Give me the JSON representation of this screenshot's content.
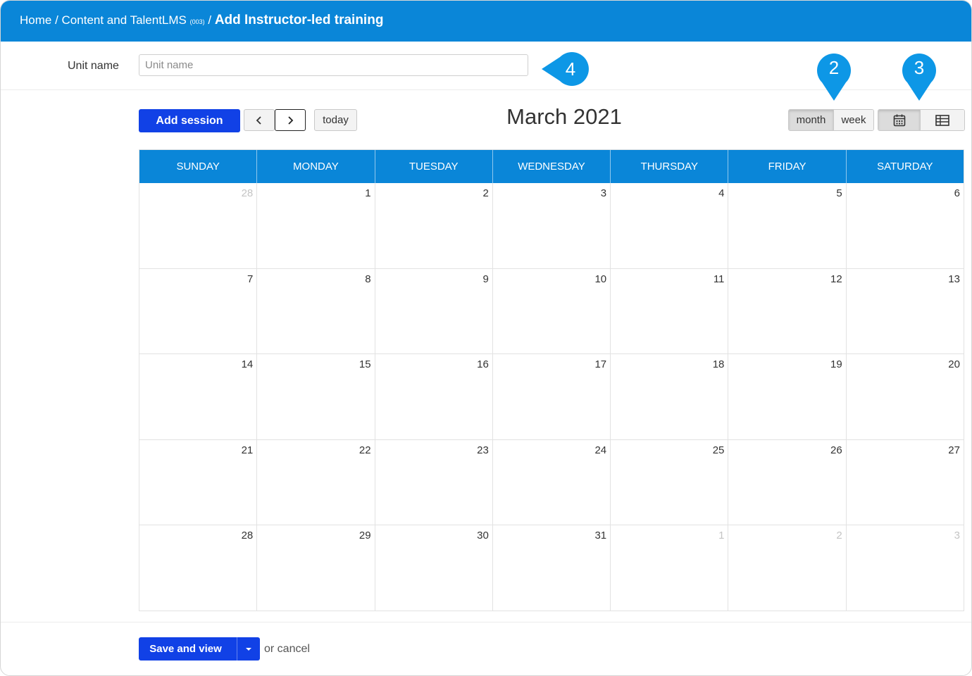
{
  "breadcrumb": {
    "home": "Home",
    "sep1": " / ",
    "course": "Content and TalentLMS ",
    "course_code": "(003)",
    "sep2": " / ",
    "current": "Add Instructor-led training"
  },
  "unit": {
    "label": "Unit name",
    "placeholder": "Unit name",
    "value": ""
  },
  "toolbar": {
    "add_session": "Add session",
    "prev_icon": "chevron-left-icon",
    "next_icon": "chevron-right-icon",
    "today": "today",
    "title": "March 2021",
    "views": {
      "month": "month",
      "week": "week",
      "active": "month"
    },
    "layout_icons": {
      "calendar": "calendar-icon",
      "list": "table-list-icon",
      "active": "calendar"
    }
  },
  "calendar": {
    "days": [
      "SUNDAY",
      "MONDAY",
      "TUESDAY",
      "WEDNESDAY",
      "THURSDAY",
      "FRIDAY",
      "SATURDAY"
    ],
    "weeks": [
      [
        {
          "d": "28",
          "other": true
        },
        {
          "d": "1"
        },
        {
          "d": "2"
        },
        {
          "d": "3"
        },
        {
          "d": "4"
        },
        {
          "d": "5"
        },
        {
          "d": "6"
        }
      ],
      [
        {
          "d": "7"
        },
        {
          "d": "8"
        },
        {
          "d": "9"
        },
        {
          "d": "10"
        },
        {
          "d": "11"
        },
        {
          "d": "12"
        },
        {
          "d": "13"
        }
      ],
      [
        {
          "d": "14"
        },
        {
          "d": "15"
        },
        {
          "d": "16"
        },
        {
          "d": "17"
        },
        {
          "d": "18"
        },
        {
          "d": "19"
        },
        {
          "d": "20"
        }
      ],
      [
        {
          "d": "21"
        },
        {
          "d": "22"
        },
        {
          "d": "23"
        },
        {
          "d": "24"
        },
        {
          "d": "25"
        },
        {
          "d": "26"
        },
        {
          "d": "27"
        }
      ],
      [
        {
          "d": "28"
        },
        {
          "d": "29"
        },
        {
          "d": "30"
        },
        {
          "d": "31"
        },
        {
          "d": "1",
          "other": true
        },
        {
          "d": "2",
          "other": true
        },
        {
          "d": "3",
          "other": true
        }
      ]
    ]
  },
  "footer": {
    "save_label": "Save and view",
    "cancel_text": "or cancel"
  },
  "callouts": {
    "c4": "4",
    "c2": "2",
    "c3": "3"
  },
  "colors": {
    "header": "#0a86d8",
    "primary_button": "#1141e6",
    "callout": "#0d97e6"
  }
}
